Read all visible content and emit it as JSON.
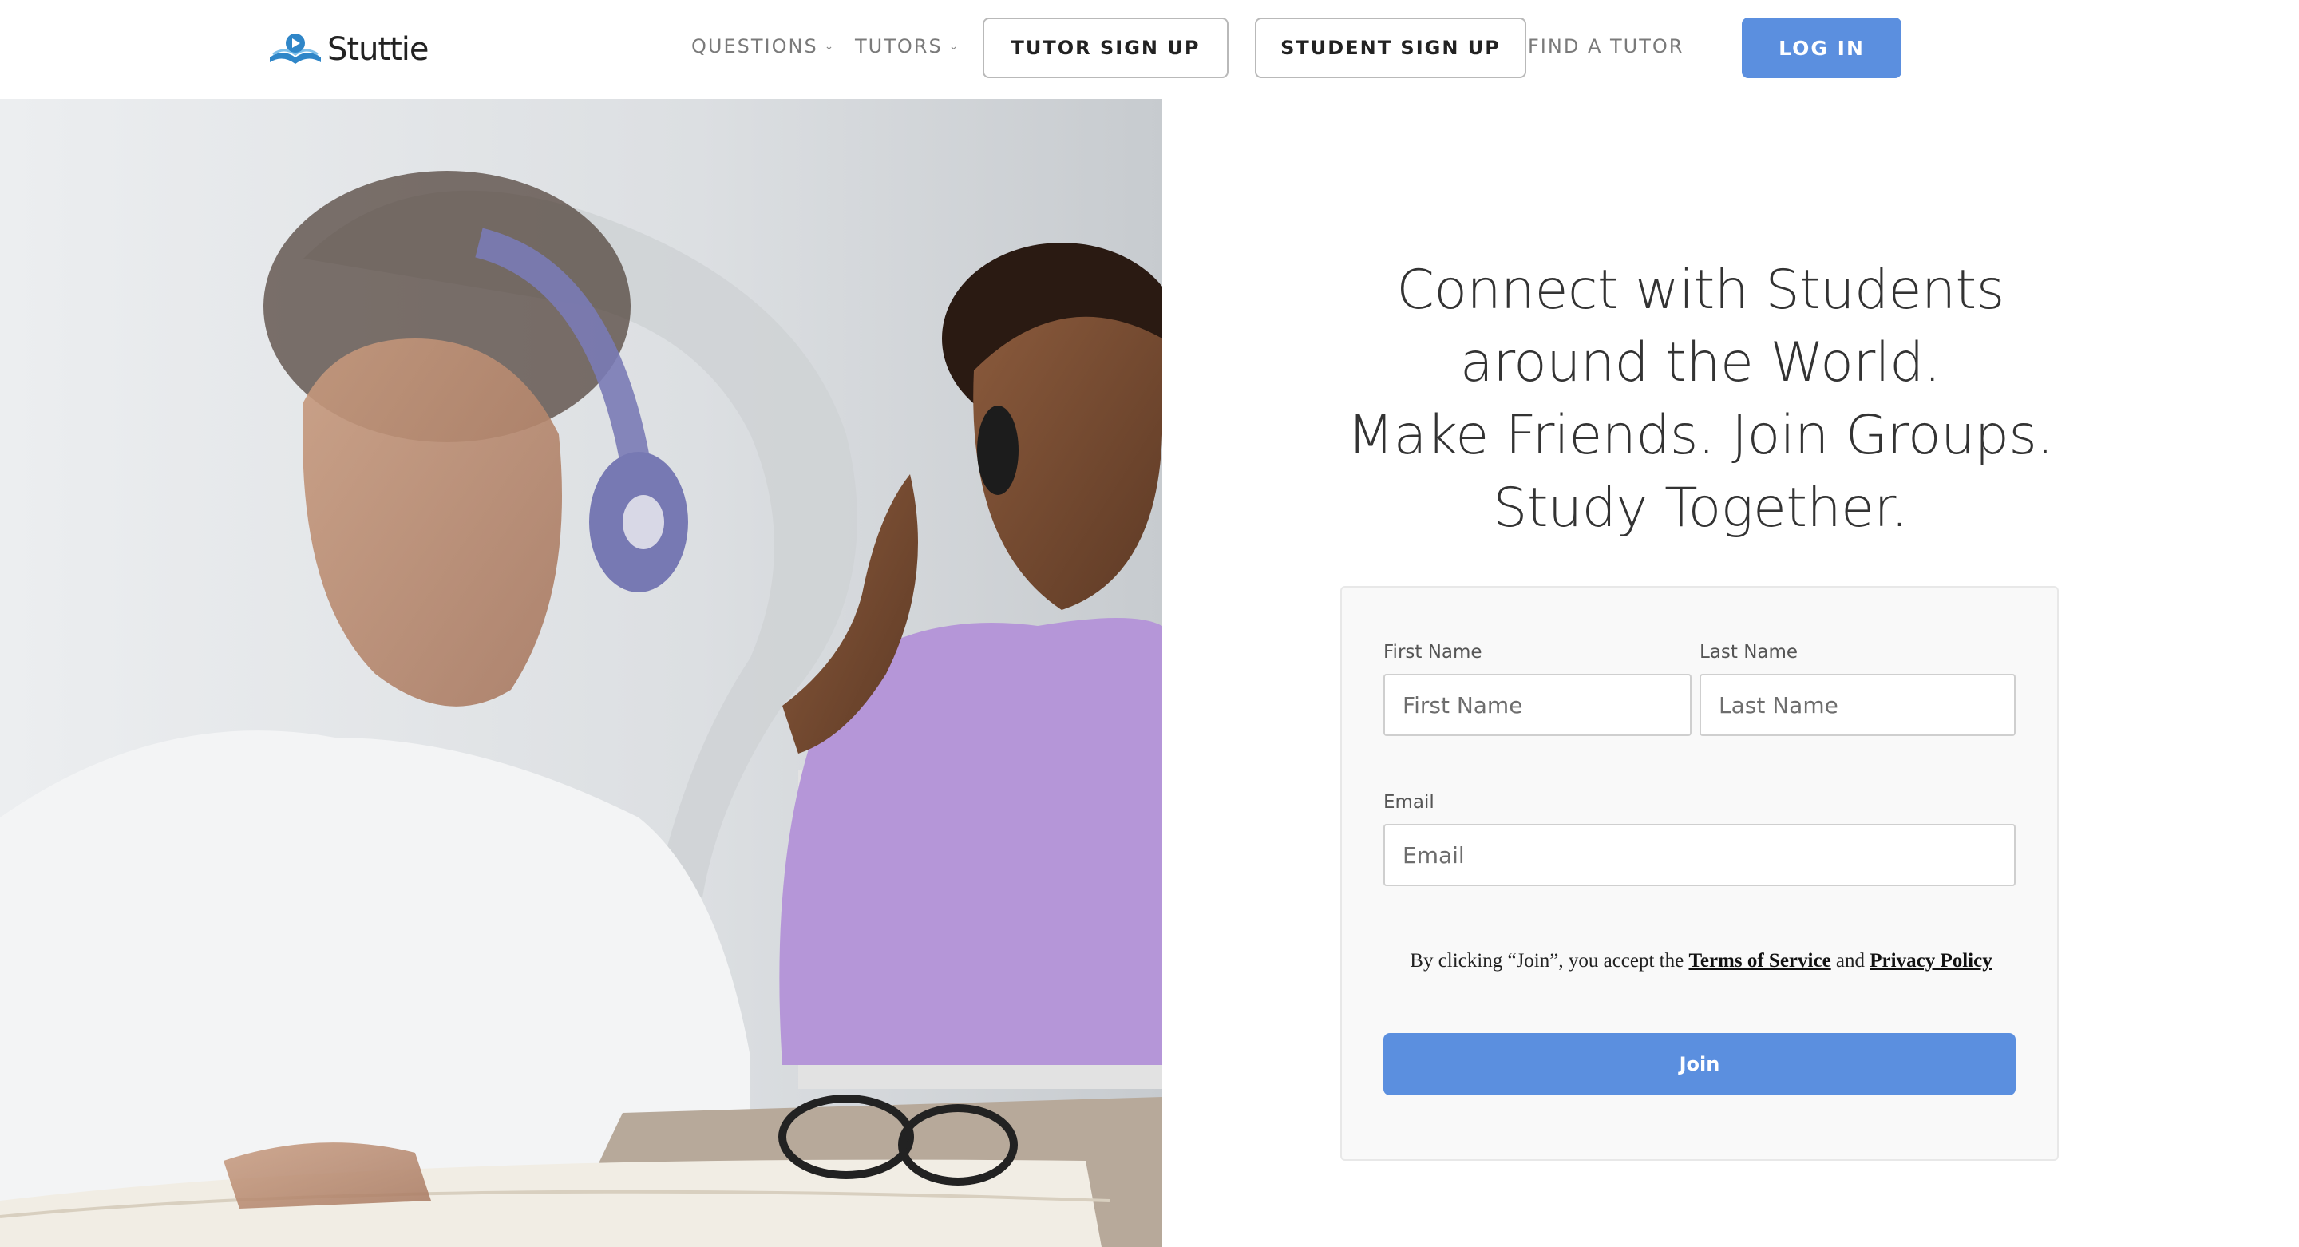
{
  "brand": {
    "name": "Stuttie",
    "accent_color": "#5b8fdf"
  },
  "nav": {
    "questions_label": "QUESTIONS",
    "tutors_label": "TUTORS",
    "tutor_signup_label": "TUTOR SIGN UP",
    "student_signup_label": "STUDENT SIGN UP",
    "find_tutor_label": "FIND A TUTOR",
    "login_label": "LOG IN",
    "dropdown_icon": "chevron-down-icon"
  },
  "hero": {
    "headline": [
      "Connect with Students",
      "around the World.",
      "Make Friends. Join Groups.",
      "Study Together."
    ]
  },
  "form": {
    "first_name_label": "First Name",
    "first_name_placeholder": "First Name",
    "last_name_label": "Last Name",
    "last_name_placeholder": "Last Name",
    "email_label": "Email",
    "email_placeholder": "Email",
    "terms_prefix": "By clicking “Join”, you accept the",
    "terms_link": "Terms of Service",
    "terms_and": "and",
    "privacy_link": "Privacy Policy",
    "join_label": "Join"
  }
}
